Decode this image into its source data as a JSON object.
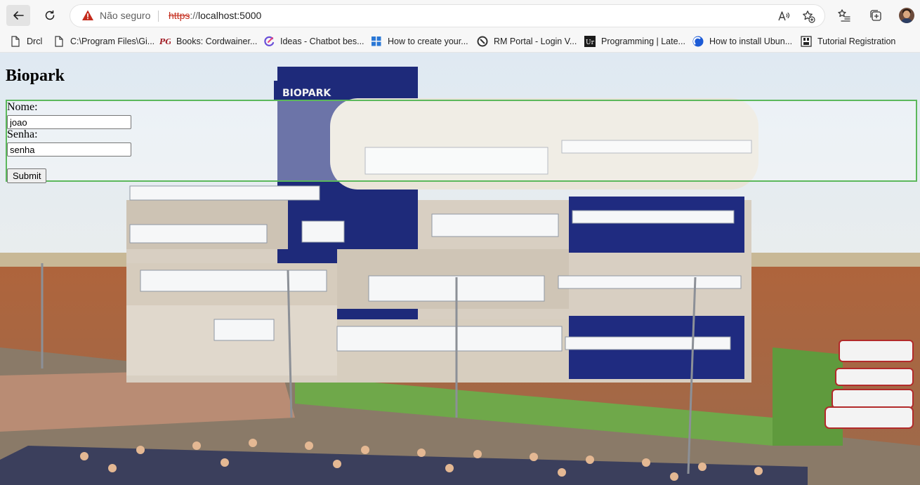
{
  "browser": {
    "address_bar": {
      "security_label": "Não seguro",
      "scheme": "https",
      "scheme_separator": "://",
      "host": "localhost:5000"
    },
    "bookmarks": [
      {
        "label": "Drcl",
        "icon": "page-icon"
      },
      {
        "label": "C:\\Program Files\\Gi...",
        "icon": "page-icon"
      },
      {
        "label": "Books: Cordwainer...",
        "icon": "pg-logo-icon"
      },
      {
        "label": "Ideas - Chatbot bes...",
        "icon": "ideas-logo-icon"
      },
      {
        "label": "How to create your...",
        "icon": "windows-logo-icon"
      },
      {
        "label": "RM Portal - Login V...",
        "icon": "rm-logo-icon"
      },
      {
        "label": "Programming | Late...",
        "icon": "latex-logo-icon"
      },
      {
        "label": "How to install Ubun...",
        "icon": "ubuntu-logo-icon"
      },
      {
        "label": "Tutorial Registration",
        "icon": "registration-logo-icon"
      }
    ],
    "colors": {
      "insecure_warning": "#c42b1c",
      "toolbar_bg": "#f7f7f7"
    }
  },
  "page": {
    "title": "Biopark",
    "form": {
      "name_label": "Nome:",
      "name_value": "joao",
      "password_label": "Senha:",
      "password_value": "senha",
      "submit_label": "Submit",
      "border_color": "#5cb85c"
    },
    "background": {
      "description_icon": "biopark-building-photo",
      "building_sign": "BIOPARK"
    }
  }
}
